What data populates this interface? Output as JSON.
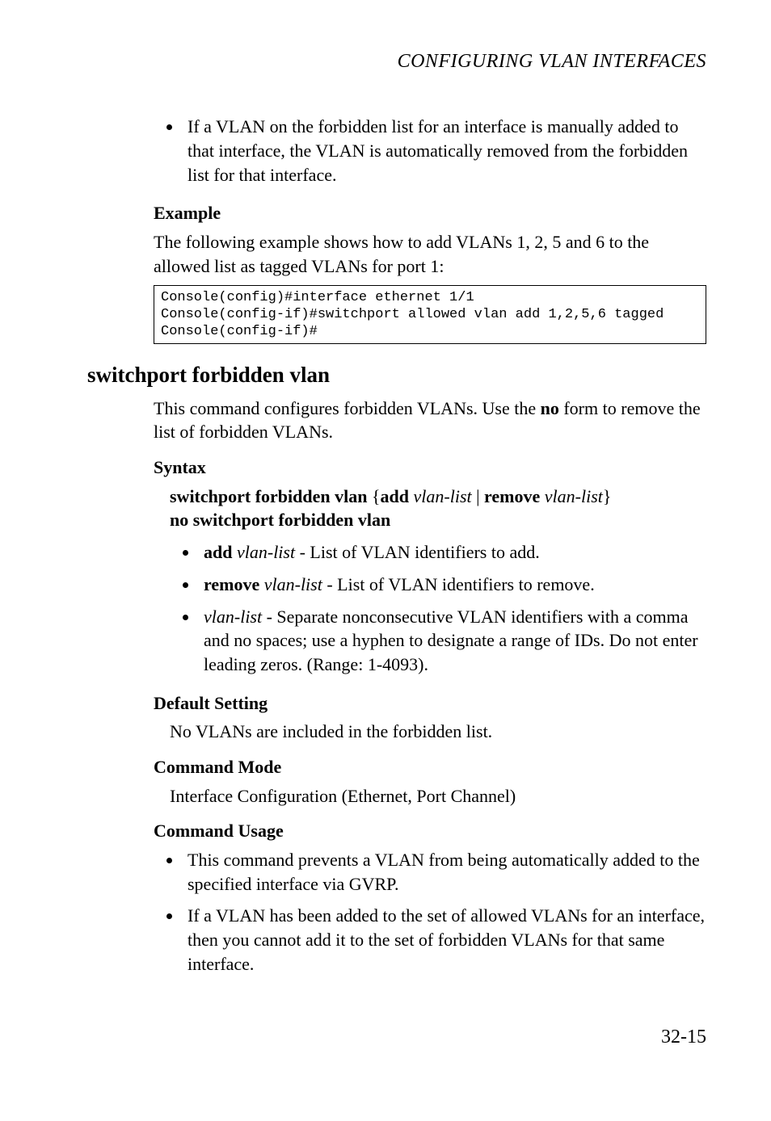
{
  "running_head": "CONFIGURING VLAN INTERFACES",
  "top_bullet": "If a VLAN on the forbidden list for an interface is manually added to that interface, the VLAN is automatically removed from the forbidden list for that interface.",
  "example": {
    "heading": "Example",
    "intro": "The following example shows how to add VLANs 1, 2, 5 and 6 to the allowed list as tagged VLANs for port 1:",
    "code": "Console(config)#interface ethernet 1/1\nConsole(config-if)#switchport allowed vlan add 1,2,5,6 tagged\nConsole(config-if)#"
  },
  "section": {
    "title": "switchport forbidden vlan",
    "intro_pre": "This command configures forbidden VLANs. Use the ",
    "intro_bold": "no",
    "intro_post": " form to remove the list of forbidden VLANs.",
    "syntax": {
      "heading": "Syntax",
      "line1": {
        "b1": "switchport forbidden vlan",
        "sep1": " {",
        "b2": "add",
        "sp1": " ",
        "i1": "vlan-list",
        "sep2": " | ",
        "b3": "remove",
        "sp2": " ",
        "i2": "vlan-list",
        "sep3": "}"
      },
      "line2": "no switchport forbidden vlan",
      "items": [
        {
          "b": "add",
          "sp": " ",
          "i": "vlan-list",
          "rest": " - List of VLAN identifiers to add."
        },
        {
          "b": "remove",
          "sp": " ",
          "i": "vlan-list",
          "rest": " - List of VLAN identifiers to remove."
        },
        {
          "i": "vlan-list",
          "rest": " - Separate nonconsecutive VLAN identifiers with a comma and no spaces; use a hyphen to designate a range of IDs. Do not enter leading zeros. (Range: 1-4093)."
        }
      ]
    },
    "default": {
      "heading": "Default Setting",
      "text": "No VLANs are included in the forbidden list."
    },
    "mode": {
      "heading": "Command Mode",
      "text": "Interface Configuration (Ethernet, Port Channel)"
    },
    "usage": {
      "heading": "Command Usage",
      "items": [
        "This command prevents a VLAN from being automatically added to the specified interface via GVRP.",
        "If a VLAN has been added to the set of allowed VLANs for an interface, then you cannot add it to the set of forbidden VLANs for that same interface."
      ]
    }
  },
  "page_number": "32-15"
}
